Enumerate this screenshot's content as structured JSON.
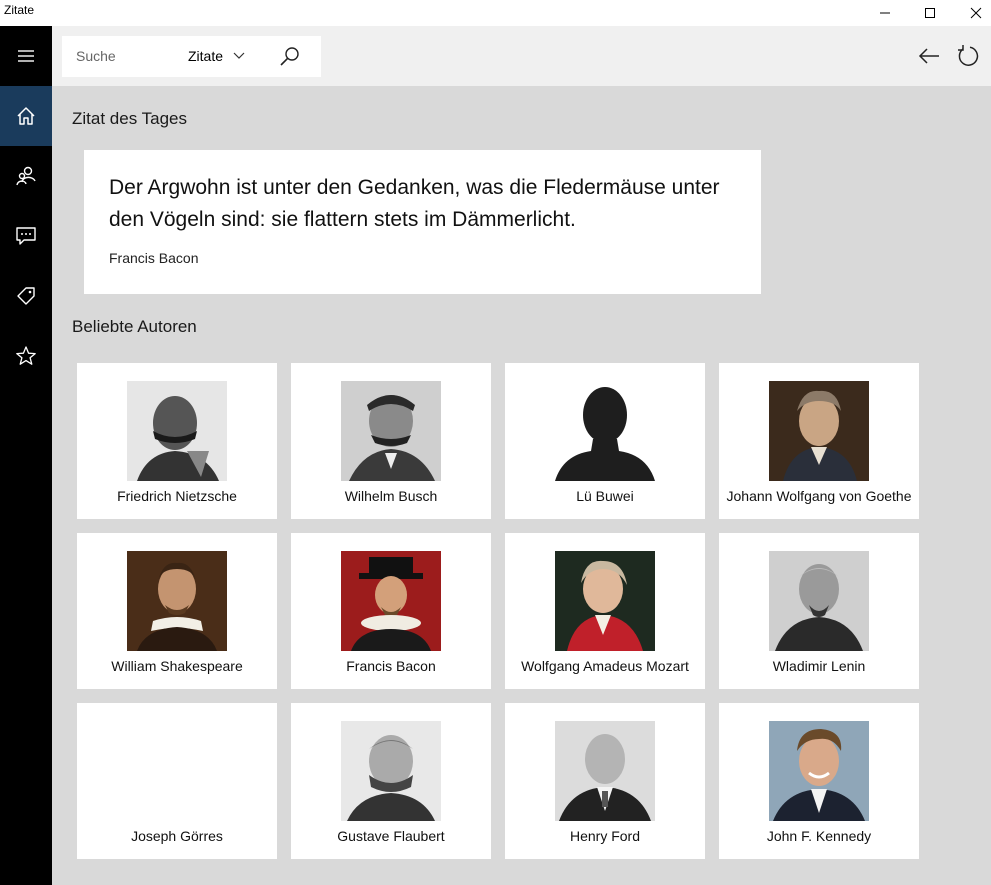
{
  "window": {
    "title": "Zitate"
  },
  "nav": {
    "items": [
      {
        "name": "home",
        "icon": "home-icon",
        "active": true
      },
      {
        "name": "authors",
        "icon": "people-icon",
        "active": false
      },
      {
        "name": "quotes",
        "icon": "speech-bubble-icon",
        "active": false
      },
      {
        "name": "tags",
        "icon": "tag-icon",
        "active": false
      },
      {
        "name": "favorites",
        "icon": "star-icon",
        "active": false
      }
    ]
  },
  "search": {
    "placeholder": "Suche",
    "scope": "Zitate"
  },
  "quote_of_day": {
    "heading": "Zitat des Tages",
    "text": "Der Argwohn ist unter den Gedanken, was die Fledermäuse unter den Vögeln sind: sie flattern stets im Dämmerlicht.",
    "author": "Francis Bacon"
  },
  "popular_authors": {
    "heading": "Beliebte Autoren",
    "authors": [
      {
        "name": "Friedrich Nietzsche",
        "portrait": "bw"
      },
      {
        "name": "Wilhelm Busch",
        "portrait": "bw"
      },
      {
        "name": "Lü Buwei",
        "portrait": "silhouette"
      },
      {
        "name": "Johann Wolfgang von Goethe",
        "portrait": "color"
      },
      {
        "name": "William Shakespeare",
        "portrait": "color"
      },
      {
        "name": "Francis Bacon",
        "portrait": "color"
      },
      {
        "name": "Wolfgang Amadeus Mozart",
        "portrait": "color"
      },
      {
        "name": "Wladimir Lenin",
        "portrait": "bw"
      },
      {
        "name": "Joseph Görres",
        "portrait": "none"
      },
      {
        "name": "Gustave Flaubert",
        "portrait": "bw"
      },
      {
        "name": "Henry Ford",
        "portrait": "bw"
      },
      {
        "name": "John F. Kennedy",
        "portrait": "color"
      }
    ]
  },
  "colors": {
    "nav_bg": "#000000",
    "nav_active": "#1a3b5c",
    "content_bg": "#d9d9d9",
    "topbar_bg": "#f0f0f0"
  }
}
